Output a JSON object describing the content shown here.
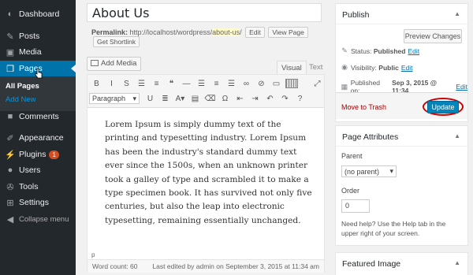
{
  "sidebar": {
    "items": [
      {
        "label": "Dashboard",
        "icon": "dashboard-icon",
        "glyph": "◐"
      },
      {
        "label": "Posts",
        "icon": "pin-icon",
        "glyph": "✎"
      },
      {
        "label": "Media",
        "icon": "media-icon",
        "glyph": "▣"
      },
      {
        "label": "Pages",
        "icon": "pages-icon",
        "glyph": "❒"
      },
      {
        "label": "Comments",
        "icon": "comments-icon",
        "glyph": "■"
      },
      {
        "label": "Appearance",
        "icon": "brush-icon",
        "glyph": "✐"
      },
      {
        "label": "Plugins",
        "icon": "plugin-icon",
        "glyph": "⚡",
        "badge": "1"
      },
      {
        "label": "Users",
        "icon": "users-icon",
        "glyph": "●"
      },
      {
        "label": "Tools",
        "icon": "tools-icon",
        "glyph": "✇"
      },
      {
        "label": "Settings",
        "icon": "settings-icon",
        "glyph": "⊞"
      },
      {
        "label": "Collapse menu",
        "icon": "collapse-icon",
        "glyph": "◀"
      }
    ],
    "submenu": [
      "All Pages",
      "Add New"
    ]
  },
  "editor": {
    "title": "About Us",
    "permalink_label": "Permalink:",
    "permalink_base": "http://localhost/wordpress/",
    "permalink_slug": "about-us",
    "permalink_tail": "/",
    "edit_btn": "Edit",
    "view_page_btn": "View Page",
    "shortlink_btn": "Get Shortlink",
    "add_media": "Add Media",
    "tab_visual": "Visual",
    "tab_text": "Text",
    "format_select": "Paragraph",
    "content": "Lorem Ipsum is simply dummy text of the printing and typesetting industry. Lorem Ipsum has been the industry's standard dummy text ever since the 1500s, when an unknown printer took a galley of type and scrambled it to make a type specimen book. It has survived not only five centuries, but also the leap into electronic typesetting, remaining essentially unchanged.",
    "path": "p",
    "word_count": "Word count: 60",
    "last_edited": "Last edited by admin on September 3, 2015 at 11:34 am"
  },
  "toolbar": {
    "row1": [
      {
        "name": "bold-icon",
        "g": "B"
      },
      {
        "name": "italic-icon",
        "g": "I"
      },
      {
        "name": "strikethrough-icon",
        "g": "S"
      },
      {
        "name": "bullet-list-icon",
        "g": "☰"
      },
      {
        "name": "numbered-list-icon",
        "g": "≡"
      },
      {
        "name": "blockquote-icon",
        "g": "❝"
      },
      {
        "name": "hr-icon",
        "g": "—"
      },
      {
        "name": "align-left-icon",
        "g": "☰"
      },
      {
        "name": "align-center-icon",
        "g": "≡"
      },
      {
        "name": "align-right-icon",
        "g": "☰"
      },
      {
        "name": "link-icon",
        "g": "∞"
      },
      {
        "name": "unlink-icon",
        "g": "⊘"
      },
      {
        "name": "more-tag-icon",
        "g": "▭"
      },
      {
        "name": "toolbar-toggle-icon",
        "g": "▦"
      }
    ],
    "fullscreen": {
      "name": "fullscreen-icon",
      "g": "⤢"
    },
    "row2": [
      {
        "name": "underline-icon",
        "g": "U"
      },
      {
        "name": "justify-icon",
        "g": "≣"
      },
      {
        "name": "text-color-icon",
        "g": "A▾"
      },
      {
        "name": "paste-text-icon",
        "g": "▤"
      },
      {
        "name": "clear-format-icon",
        "g": "⌫"
      },
      {
        "name": "omega-icon",
        "g": "Ω"
      },
      {
        "name": "outdent-icon",
        "g": "⇤"
      },
      {
        "name": "indent-icon",
        "g": "⇥"
      },
      {
        "name": "undo-icon",
        "g": "↶"
      },
      {
        "name": "redo-icon",
        "g": "↷"
      },
      {
        "name": "help-icon",
        "g": "?"
      }
    ]
  },
  "publish": {
    "title": "Publish",
    "preview_btn": "Preview Changes",
    "status_label": "Status:",
    "status_value": "Published",
    "visibility_label": "Visibility:",
    "visibility_value": "Public",
    "published_label": "Published on:",
    "published_value": "Sep 3, 2015 @ 11:34",
    "edit_link": "Edit",
    "trash": "Move to Trash",
    "update_btn": "Update"
  },
  "page_attributes": {
    "title": "Page Attributes",
    "parent_label": "Parent",
    "parent_value": "(no parent)",
    "order_label": "Order",
    "order_value": "0",
    "help": "Need help? Use the Help tab in the upper right of your screen."
  },
  "featured": {
    "title": "Featured Image"
  },
  "colors": {
    "sidebar": "#23282d",
    "active": "#0073aa",
    "update": "#0085ba",
    "ring": "#cc0000"
  }
}
